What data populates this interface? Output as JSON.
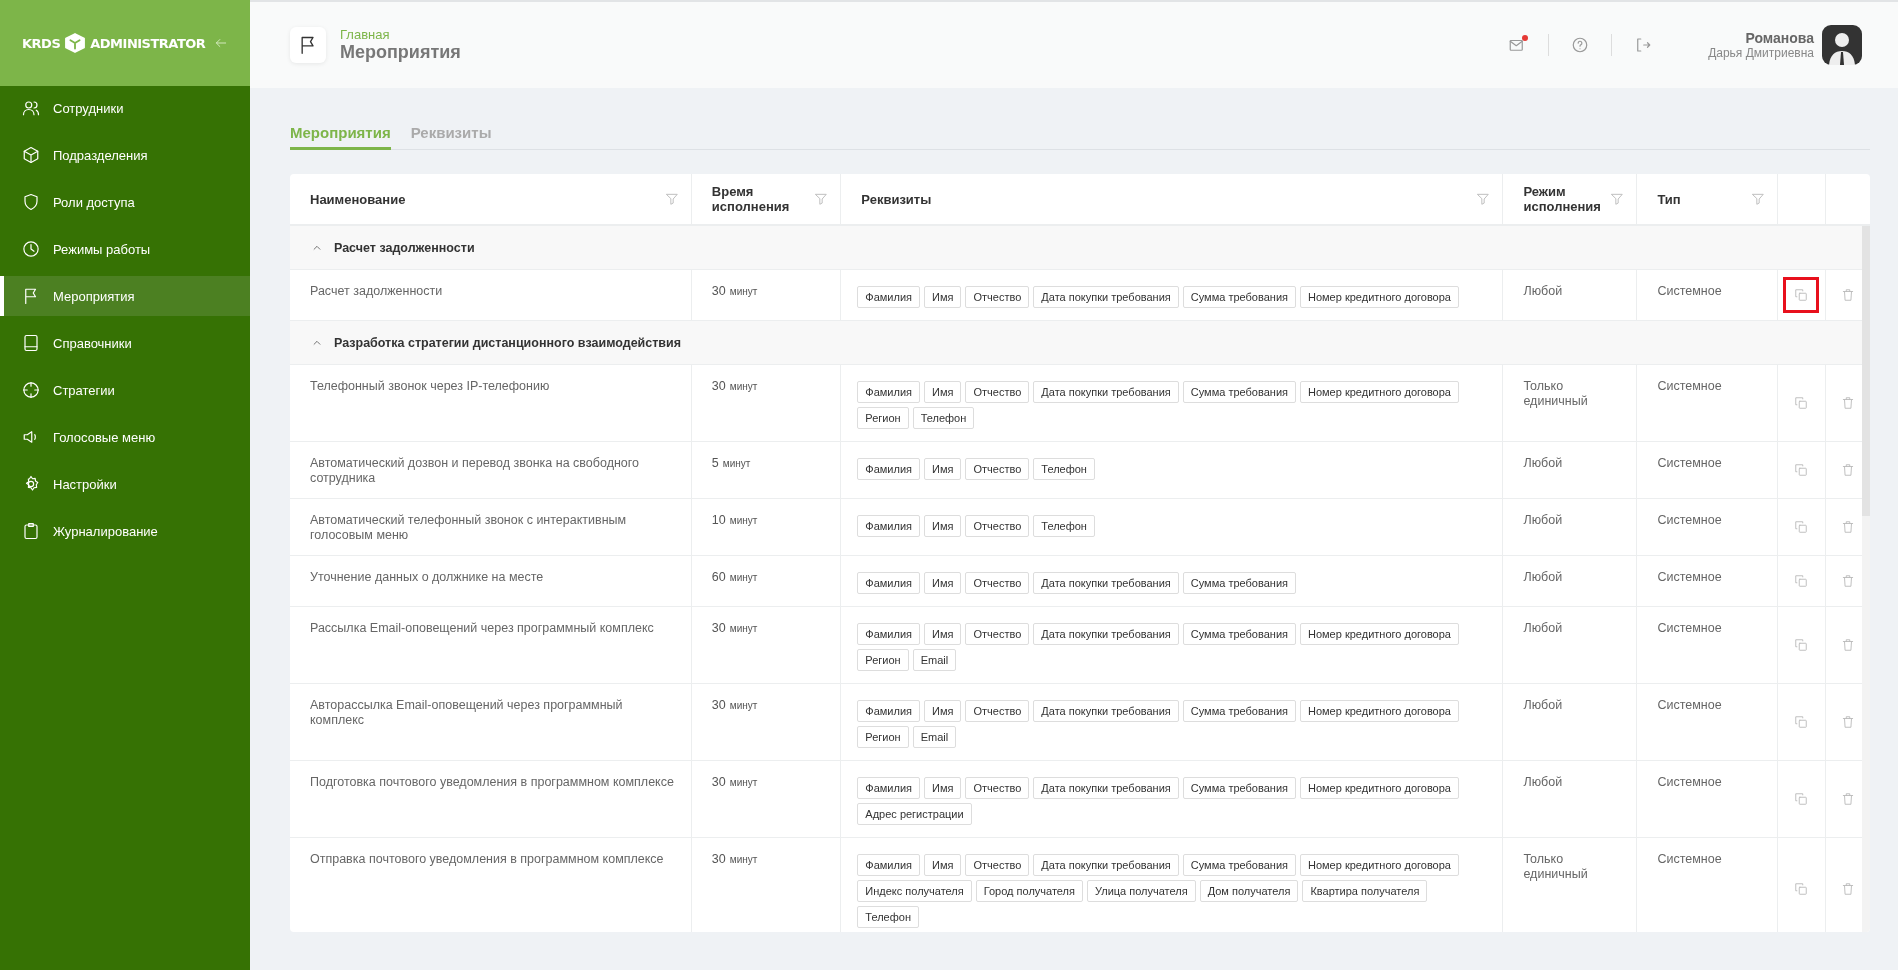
{
  "sidebar": {
    "logo_left": "KRDS",
    "logo_right": "ADMINISTRATOR",
    "items": [
      {
        "label": "Сотрудники",
        "selected": false
      },
      {
        "label": "Подразделения",
        "selected": false
      },
      {
        "label": "Роли доступа",
        "selected": false
      },
      {
        "label": "Режимы работы",
        "selected": false
      },
      {
        "label": "Мероприятия",
        "selected": true
      },
      {
        "label": "Справочники",
        "selected": false
      },
      {
        "label": "Стратегии",
        "selected": false
      },
      {
        "label": "Голосовые меню",
        "selected": false
      },
      {
        "label": "Настройки",
        "selected": false
      },
      {
        "label": "Журналирование",
        "selected": false
      }
    ]
  },
  "header": {
    "breadcrumb": "Главная",
    "title": "Мероприятия",
    "has_unread_mail": true,
    "user": {
      "last_name": "Романова",
      "first_names": "Дарья Дмитриевна"
    }
  },
  "tabs": [
    {
      "label": "Мероприятия",
      "selected": true
    },
    {
      "label": "Реквизиты",
      "selected": false
    }
  ],
  "table": {
    "columns": [
      {
        "label": "Наименование",
        "filter": true
      },
      {
        "label": "Время исполнения",
        "filter": true
      },
      {
        "label": "Реквизиты",
        "filter": true
      },
      {
        "label": "Режим исполнения",
        "filter": true
      },
      {
        "label": "Тип",
        "filter": true
      }
    ],
    "groups": [
      {
        "title": "Расчет задолженности",
        "expanded": true,
        "rows": [
          {
            "name": "Расчет задолженности",
            "duration": "30",
            "unit": "минут",
            "requisites": [
              "Фамилия",
              "Имя",
              "Отчество",
              "Дата покупки требования",
              "Сумма требования",
              "Номер кредитного договора"
            ],
            "mode": "Любой",
            "type": "Системное",
            "copy_highlighted": true
          }
        ]
      },
      {
        "title": "Разработка стратегии дистанционного взаимодействия",
        "expanded": true,
        "rows": [
          {
            "name": "Телефонный звонок через IP-телефонию",
            "duration": "30",
            "unit": "минут",
            "requisites": [
              "Фамилия",
              "Имя",
              "Отчество",
              "Дата покупки требования",
              "Сумма требования",
              "Номер кредитного договора",
              "Регион",
              "Телефон"
            ],
            "mode": "Только единичный",
            "type": "Системное",
            "copy_highlighted": false
          },
          {
            "name": "Автоматический дозвон и перевод звонка на свободного сотрудника",
            "duration": "5",
            "unit": "минут",
            "requisites": [
              "Фамилия",
              "Имя",
              "Отчество",
              "Телефон"
            ],
            "mode": "Любой",
            "type": "Системное",
            "copy_highlighted": false
          },
          {
            "name": "Автоматический телефонный звонок с интерактивным голосовым меню",
            "duration": "10",
            "unit": "минут",
            "requisites": [
              "Фамилия",
              "Имя",
              "Отчество",
              "Телефон"
            ],
            "mode": "Любой",
            "type": "Системное",
            "copy_highlighted": false
          },
          {
            "name": "Уточнение данных о должнике на месте",
            "duration": "60",
            "unit": "минут",
            "requisites": [
              "Фамилия",
              "Имя",
              "Отчество",
              "Дата покупки требования",
              "Сумма требования"
            ],
            "mode": "Любой",
            "type": "Системное",
            "copy_highlighted": false
          },
          {
            "name": "Рассылка Email-оповещений через программный комплекс",
            "duration": "30",
            "unit": "минут",
            "requisites": [
              "Фамилия",
              "Имя",
              "Отчество",
              "Дата покупки требования",
              "Сумма требования",
              "Номер кредитного договора",
              "Регион",
              "Email"
            ],
            "mode": "Любой",
            "type": "Системное",
            "copy_highlighted": false
          },
          {
            "name": "Авторассылка Email-оповещений через программный комплекс",
            "duration": "30",
            "unit": "минут",
            "requisites": [
              "Фамилия",
              "Имя",
              "Отчество",
              "Дата покупки требования",
              "Сумма требования",
              "Номер кредитного договора",
              "Регион",
              "Email"
            ],
            "mode": "Любой",
            "type": "Системное",
            "copy_highlighted": false
          },
          {
            "name": "Подготовка почтового уведомления в программном комплексе",
            "duration": "30",
            "unit": "минут",
            "requisites": [
              "Фамилия",
              "Имя",
              "Отчество",
              "Дата покупки требования",
              "Сумма требования",
              "Номер кредитного договора",
              "Адрес регистрации"
            ],
            "mode": "Любой",
            "type": "Системное",
            "copy_highlighted": false
          },
          {
            "name": "Отправка почтового уведомления в программном комплексе",
            "duration": "30",
            "unit": "минут",
            "requisites": [
              "Фамилия",
              "Имя",
              "Отчество",
              "Дата покупки требования",
              "Сумма требования",
              "Номер кредитного договора",
              "Индекс получателя",
              "Город получателя",
              "Улица получателя",
              "Дом получателя",
              "Квартира получателя",
              "Телефон"
            ],
            "mode": "Только единичный",
            "type": "Системное",
            "copy_highlighted": false
          }
        ]
      }
    ]
  }
}
